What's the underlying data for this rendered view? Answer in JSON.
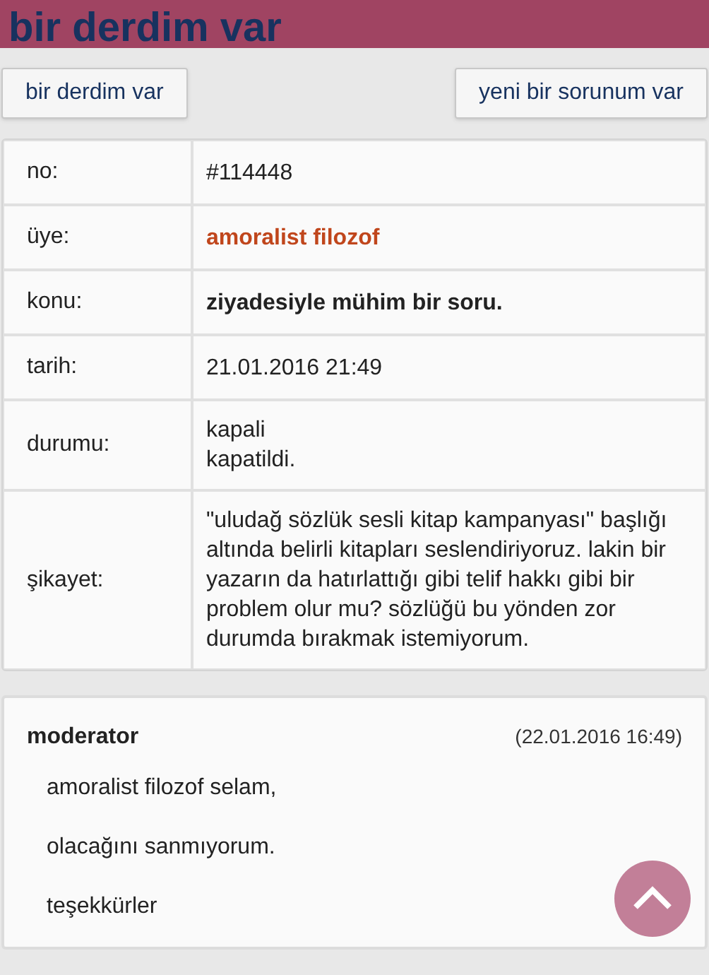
{
  "header": {
    "title": "bir derdim var"
  },
  "buttons": [
    "bir derdim var",
    "yeni bir sorunum var"
  ],
  "details": [
    {
      "label": "no:",
      "kind": "plain",
      "lines": [
        "#114448"
      ]
    },
    {
      "label": "üye:",
      "kind": "member",
      "lines": [
        "amoralist filozof"
      ]
    },
    {
      "label": "konu:",
      "kind": "bold",
      "lines": [
        "ziyadesiyle mühim bir soru."
      ]
    },
    {
      "label": "tarih:",
      "kind": "plain",
      "lines": [
        "21.01.2016 21:49"
      ]
    },
    {
      "label": "durumu:",
      "kind": "plain",
      "lines": [
        "kapali",
        "kapatildi."
      ]
    },
    {
      "label": "şikayet:",
      "kind": "plain",
      "lines": [
        "\"uludağ sözlük sesli kitap kampanyası\" başlığı altında belirli kitapları seslendiriyoruz. lakin bir yazarın da hatırlattığı gibi telif hakkı gibi bir problem olur mu? sözlüğü bu yönden zor durumda bırakmak istemiyorum."
      ]
    }
  ],
  "reply": {
    "author": "moderator",
    "date": "(22.01.2016 16:49)",
    "paragraphs": [
      "amoralist filozof selam,",
      "olacağını sanmıyorum.",
      "teşekkürler"
    ]
  }
}
